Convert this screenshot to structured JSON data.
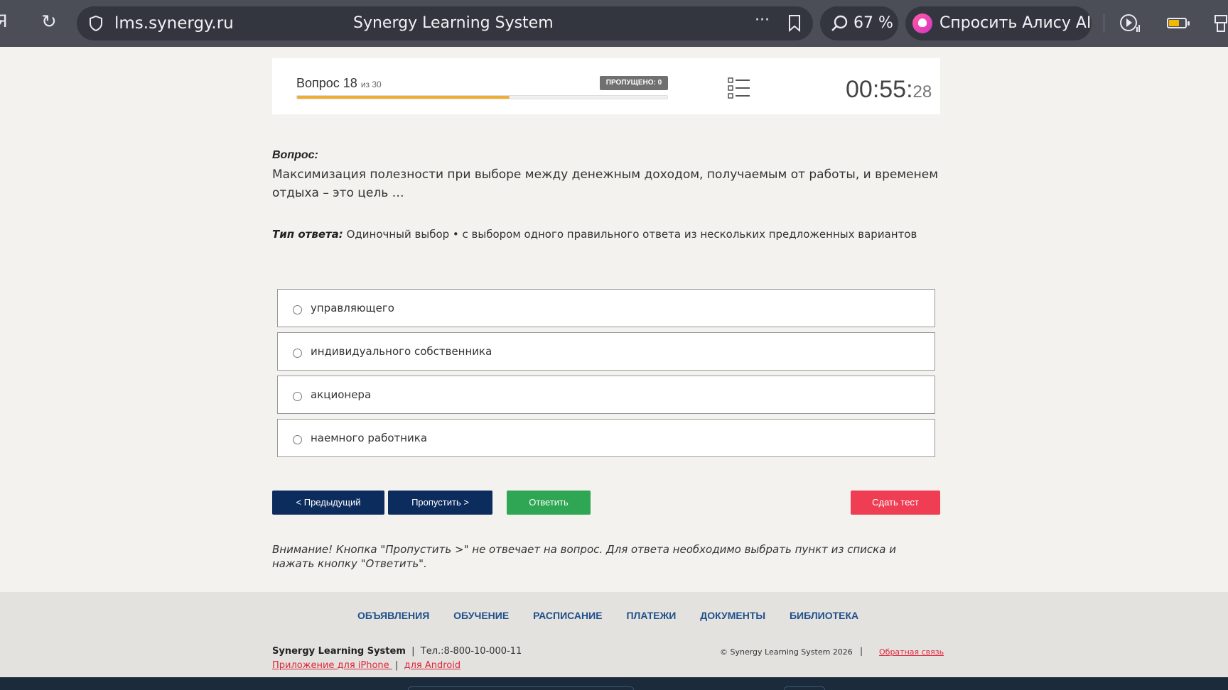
{
  "browser": {
    "url": "lms.synergy.ru",
    "title": "Synergy Learning System",
    "zoom": "67 %",
    "alice_label": "Спросить Алису AI",
    "more_label": "···"
  },
  "header": {
    "question_label": "Вопрос 18",
    "question_total": "из 30",
    "skipped_badge": "ПРОПУЩЕНО: 0",
    "progress_fraction": 0.573,
    "timer_main": "00:55:",
    "timer_seconds": "28"
  },
  "question": {
    "label": "Вопрос:",
    "text": "Максимизация полезности при выборе между денежным доходом, получаемым от работы, и временем отдыха – это цель …",
    "type_label": "Тип ответа:",
    "type_value": " Одиночный выбор • с выбором одного правильного ответа из нескольких предложенных вариантов"
  },
  "options": [
    {
      "label": "управляющего"
    },
    {
      "label": "индивидуального собственника"
    },
    {
      "label": "акционера"
    },
    {
      "label": "наемного работника"
    }
  ],
  "buttons": {
    "prev": "< Предыдущий",
    "skip": "Пропустить >",
    "answer": "Ответить",
    "submit": "Сдать тест"
  },
  "warning": "Внимание! Кнопка \"Пропустить >\" не отвечает на вопрос. Для ответа необходимо выбрать пункт из списка и нажать кнопку \"Ответить\".",
  "footer": {
    "nav": [
      "ОБЪЯВЛЕНИЯ",
      "ОБУЧЕНИЕ",
      "РАСПИСАНИЕ",
      "ПЛАТЕЖИ",
      "ДОКУМЕНТЫ",
      "БИБЛИОТЕКА"
    ],
    "brand": "Synergy Learning System",
    "phone": "Тел.:8-800-10-000-11",
    "app_iphone": "Приложение для iPhone ",
    "app_android": "для Android",
    "copyright": "© Synergy Learning System 2026",
    "feedback": "Обратная связь"
  },
  "colors": {
    "primary_button": "#0d2c5e",
    "answer_button": "#2ea653",
    "submit_button": "#ef3e54",
    "progress": "#f0ad31"
  }
}
